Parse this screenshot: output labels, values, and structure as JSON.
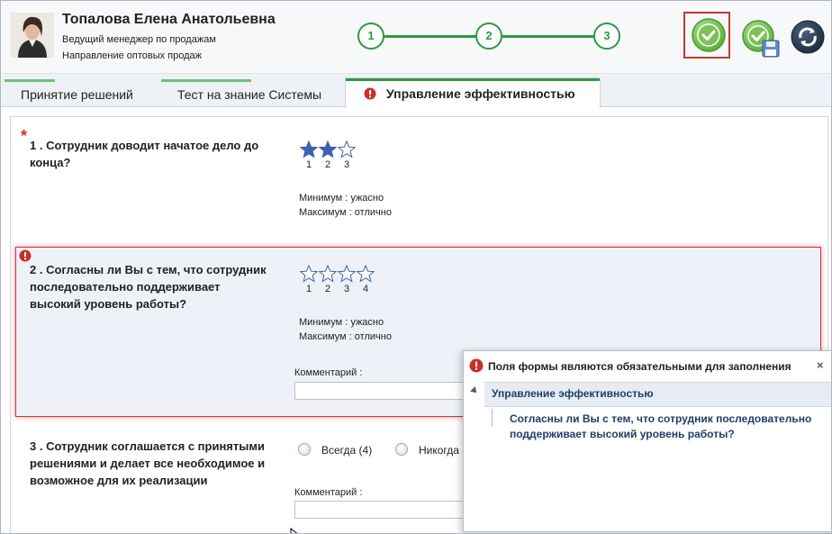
{
  "employee": {
    "name": "Топалова Елена Анатольевна",
    "position": "Ведущий менеджер по продажам",
    "department": "Направление оптовых продаж"
  },
  "steps": [
    "1",
    "2",
    "3"
  ],
  "tabs": [
    {
      "label": "Принятие решений"
    },
    {
      "label": "Тест на знание Системы"
    },
    {
      "label": "Управление эффективностью"
    }
  ],
  "questions": {
    "q1": {
      "text": "1 . Сотрудник доводит начатое дело до конца?",
      "required_mark": "*",
      "stars_total": 3,
      "stars_selected": 2,
      "star_numbers": [
        "1",
        "2",
        "3"
      ],
      "min_label": "Минимум : ужасно",
      "max_label": "Максимум : отлично"
    },
    "q2": {
      "text": "2 . Согласны ли Вы с тем, что сотрудник последовательно поддерживает высокий уровень работы?",
      "stars_total": 4,
      "stars_selected": 0,
      "star_numbers": [
        "1",
        "2",
        "3",
        "4"
      ],
      "min_label": "Минимум : ужасно",
      "max_label": "Максимум : отлично",
      "comment_label": "Комментарий :",
      "comment_value": ""
    },
    "q3": {
      "text": "3 . Сотрудник соглашается с принятыми решениями и делает все необходимое и возможное для их реализации",
      "options": [
        "Всегда (4)",
        "Никогда"
      ],
      "comment_label": "Комментарий :",
      "comment_value": ""
    }
  },
  "popup": {
    "title": "Поля формы являются обязательными для заполнения",
    "close": "×",
    "group": "Управление эффективностью",
    "item": "Согласны ли Вы с тем, что сотрудник последовательно поддерживает высокий уровень работы?"
  },
  "colors": {
    "accent_green": "#2e9a3f",
    "error_red": "#d8313a",
    "star_blue": "#3a62b0"
  },
  "icons": [
    "approve-icon",
    "save-approve-icon",
    "refresh-icon",
    "warning-icon",
    "star-icon"
  ]
}
